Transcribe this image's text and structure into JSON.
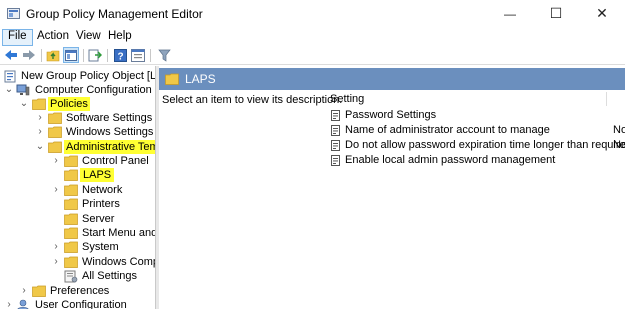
{
  "window": {
    "title": "Group Policy Management Editor",
    "minimize_glyph": "—",
    "maximize_glyph": "☐",
    "close_glyph": "✕"
  },
  "menu": [
    "File",
    "Action",
    "View",
    "Help"
  ],
  "toolbar": {
    "icons": [
      "back-arrow-icon",
      "forward-arrow-icon",
      "up-folder-icon",
      "show-hide-tree-icon",
      "export-list-icon",
      "help-icon",
      "properties-icon",
      "filter-icon"
    ]
  },
  "tree": {
    "root": "New Group Policy Object [LAPS",
    "computer_configuration": "Computer Configuration",
    "policies": "Policies",
    "software_settings": "Software Settings",
    "windows_settings": "Windows Settings",
    "administrative_templates": "Administrative Temp",
    "control_panel": "Control Panel",
    "laps": "LAPS",
    "network": "Network",
    "printers": "Printers",
    "server": "Server",
    "start_menu": "Start Menu and T",
    "system": "System",
    "windows_components": "Windows Compo",
    "all_settings": "All Settings",
    "preferences": "Preferences",
    "user_configuration": "User Configuration"
  },
  "right_pane": {
    "title": "LAPS",
    "description": "Select an item to view its description.",
    "column_setting": "Setting",
    "settings": [
      {
        "label": "Password Settings",
        "state": ""
      },
      {
        "label": "Name of administrator account to manage",
        "state": "No"
      },
      {
        "label": "Do not allow password expiration time longer than required ...",
        "state": "No"
      },
      {
        "label": "Enable local admin password management",
        "state": ""
      }
    ]
  },
  "colors": {
    "header_bg": "#6b8fbe",
    "highlight": "#ffff33",
    "folder": "#f0c848"
  }
}
